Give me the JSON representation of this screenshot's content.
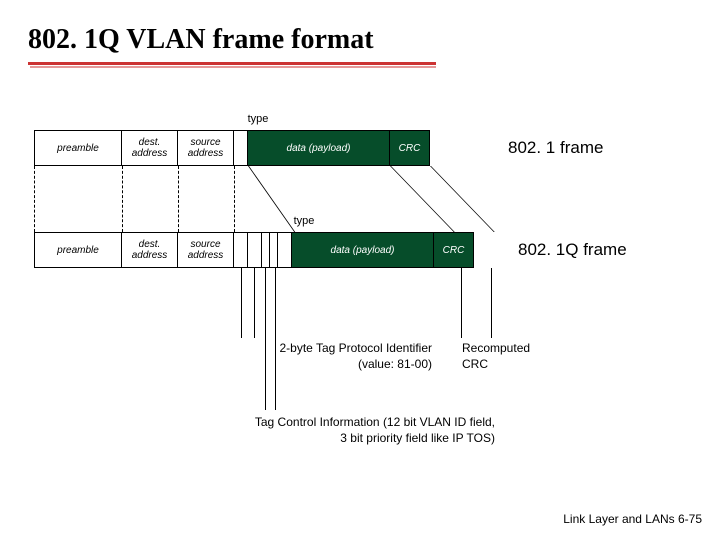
{
  "title": "802. 1Q VLAN frame format",
  "labels": {
    "type": "type",
    "frame8021": "802. 1 frame",
    "frame8021q": "802. 1Q frame"
  },
  "fields": {
    "preamble": "preamble",
    "dest": "dest.\naddress",
    "src": "source\naddress",
    "data": "data (payload)",
    "crc": "CRC"
  },
  "annotations": {
    "tpid": "2-byte Tag Protocol Identifier\n(value: 81-00)",
    "recomputed": "Recomputed\nCRC",
    "tci": "Tag Control Information (12 bit VLAN ID field,\n3 bit priority field like IP TOS)"
  },
  "footer": "Link Layer and LANs   6-75"
}
